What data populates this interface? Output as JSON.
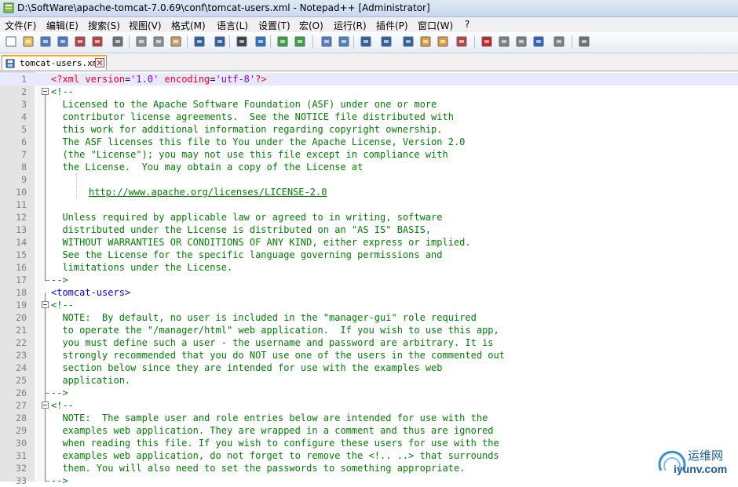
{
  "window": {
    "title": "D:\\SoftWare\\apache-tomcat-7.0.69\\conf\\tomcat-users.xml - Notepad++ [Administrator]"
  },
  "menu": [
    "文件(F)",
    "编辑(E)",
    "搜索(S)",
    "视图(V)",
    "格式(M)",
    "语言(L)",
    "设置(T)",
    "宏(O)",
    "运行(R)",
    "插件(P)",
    "窗口(W)",
    "?"
  ],
  "toolbar": {
    "icons": [
      "new-file-icon",
      "open-file-icon",
      "save-icon",
      "save-all-icon",
      "close-icon",
      "close-all-icon",
      "print-icon",
      "cut-icon",
      "copy-icon",
      "paste-icon",
      "undo-icon",
      "redo-icon",
      "find-icon",
      "replace-icon",
      "zoom-in-icon",
      "zoom-out-icon",
      "sync-vertical-icon",
      "sync-horizontal-icon",
      "word-wrap-icon",
      "show-all-chars-icon",
      "indent-guide-icon",
      "user-language-icon",
      "doc-map-icon",
      "function-list-icon",
      "record-macro-icon",
      "stop-record-icon",
      "play-macro-icon",
      "run-macro-multiple-icon",
      "save-macro-icon",
      "spell-check-icon"
    ]
  },
  "tabs": [
    {
      "label": "tomcat-users.xml",
      "active": true
    }
  ],
  "editor": {
    "lines": [
      {
        "n": "1",
        "text": "<?xml version='1.0' encoding='utf-8'?>",
        "kind": "pi"
      },
      {
        "n": "2",
        "text": "<!--",
        "kind": "comment"
      },
      {
        "n": "3",
        "text": "  Licensed to the Apache Software Foundation (ASF) under one or more",
        "kind": "comment"
      },
      {
        "n": "4",
        "text": "  contributor license agreements.  See the NOTICE file distributed with",
        "kind": "comment"
      },
      {
        "n": "5",
        "text": "  this work for additional information regarding copyright ownership.",
        "kind": "comment"
      },
      {
        "n": "6",
        "text": "  The ASF licenses this file to You under the Apache License, Version 2.0",
        "kind": "comment"
      },
      {
        "n": "7",
        "text": "  (the \"License\"); you may not use this file except in compliance with",
        "kind": "comment"
      },
      {
        "n": "8",
        "text": "  the License.  You may obtain a copy of the License at",
        "kind": "comment"
      },
      {
        "n": "9",
        "text": "",
        "kind": "comment"
      },
      {
        "n": "10",
        "text": "http://www.apache.org/licenses/LICENSE-2.0",
        "kind": "link"
      },
      {
        "n": "11",
        "text": "",
        "kind": "comment"
      },
      {
        "n": "12",
        "text": "  Unless required by applicable law or agreed to in writing, software",
        "kind": "comment"
      },
      {
        "n": "13",
        "text": "  distributed under the License is distributed on an \"AS IS\" BASIS,",
        "kind": "comment"
      },
      {
        "n": "14",
        "text": "  WITHOUT WARRANTIES OR CONDITIONS OF ANY KIND, either express or implied.",
        "kind": "comment"
      },
      {
        "n": "15",
        "text": "  See the License for the specific language governing permissions and",
        "kind": "comment"
      },
      {
        "n": "16",
        "text": "  limitations under the License.",
        "kind": "comment"
      },
      {
        "n": "17",
        "text": "-->",
        "kind": "comment"
      },
      {
        "n": "18",
        "text": "<tomcat-users>",
        "kind": "tag"
      },
      {
        "n": "19",
        "text": "<!--",
        "kind": "comment"
      },
      {
        "n": "20",
        "text": "  NOTE:  By default, no user is included in the \"manager-gui\" role required",
        "kind": "comment"
      },
      {
        "n": "21",
        "text": "  to operate the \"/manager/html\" web application.  If you wish to use this app,",
        "kind": "comment"
      },
      {
        "n": "22",
        "text": "  you must define such a user - the username and password are arbitrary. It is",
        "kind": "comment"
      },
      {
        "n": "23",
        "text": "  strongly recommended that you do NOT use one of the users in the commented out",
        "kind": "comment"
      },
      {
        "n": "24",
        "text": "  section below since they are intended for use with the examples web",
        "kind": "comment"
      },
      {
        "n": "25",
        "text": "  application.",
        "kind": "comment"
      },
      {
        "n": "26",
        "text": "-->",
        "kind": "comment"
      },
      {
        "n": "27",
        "text": "<!--",
        "kind": "comment"
      },
      {
        "n": "28",
        "text": "  NOTE:  The sample user and role entries below are intended for use with the",
        "kind": "comment"
      },
      {
        "n": "29",
        "text": "  examples web application. They are wrapped in a comment and thus are ignored",
        "kind": "comment"
      },
      {
        "n": "30",
        "text": "  when reading this file. If you wish to configure these users for use with the",
        "kind": "comment"
      },
      {
        "n": "31",
        "text": "  examples web application, do not forget to remove the <!.. ..> that surrounds",
        "kind": "comment"
      },
      {
        "n": "32",
        "text": "  them. You will also need to set the passwords to something appropriate.",
        "kind": "comment"
      },
      {
        "n": "33",
        "text": "-->",
        "kind": "comment"
      }
    ]
  },
  "watermark": {
    "line1": "运维网",
    "line2": "iyunv.com"
  },
  "colors": {
    "comment": "#008000",
    "tag": "#0000ff",
    "pi": "#ff0000",
    "value": "#8000ff",
    "current_line": "#e8e8ff"
  }
}
